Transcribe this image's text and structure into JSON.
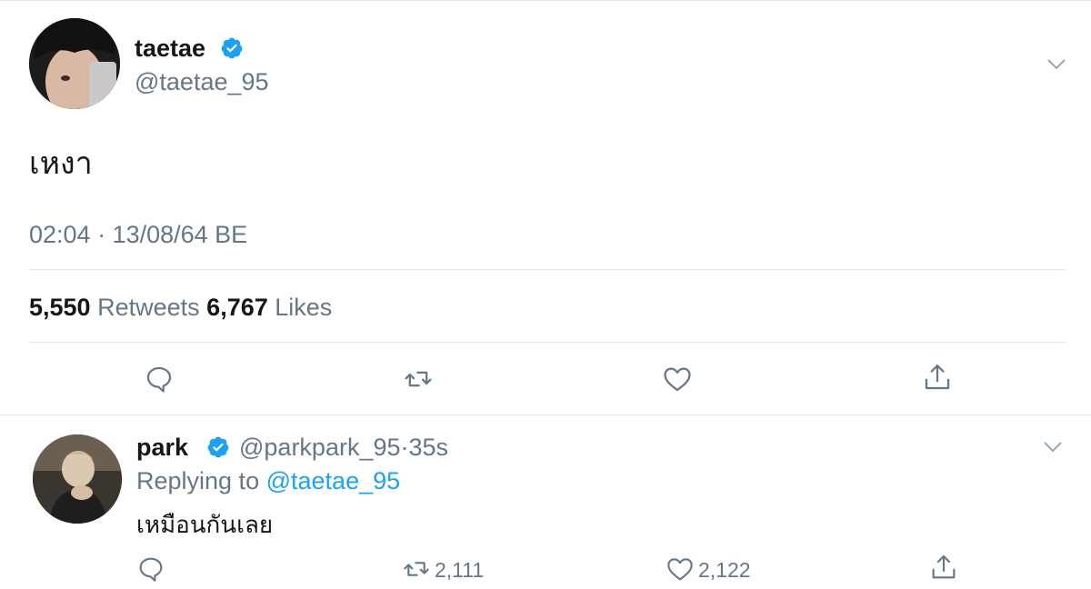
{
  "tweet": {
    "display_name": "taetae",
    "handle": "@taetae_95",
    "text": "เหงา",
    "timestamp": "02:04 · 13/08/64 BE",
    "retweets_count": "5,550",
    "retweets_label": "Retweets",
    "likes_count": "6,767",
    "likes_label": "Likes"
  },
  "reply": {
    "display_name": "park",
    "handle": "@parkpark_95",
    "separator": "·",
    "time": "35s",
    "replying_to_prefix": "Replying to",
    "replying_to_handle": "@taetae_95",
    "text": "เหมือนกันเลย",
    "retweets_count": "2,111",
    "likes_count": "2,122"
  },
  "icons": {
    "verified": "verified-badge-icon",
    "menu": "chevron-down-icon",
    "reply": "reply-icon",
    "retweet": "retweet-icon",
    "like": "heart-icon",
    "share": "share-icon"
  },
  "colors": {
    "accent": "#1da1f2",
    "secondary_text": "#657786",
    "primary_text": "#14171a",
    "divider": "#e1e8ed"
  }
}
